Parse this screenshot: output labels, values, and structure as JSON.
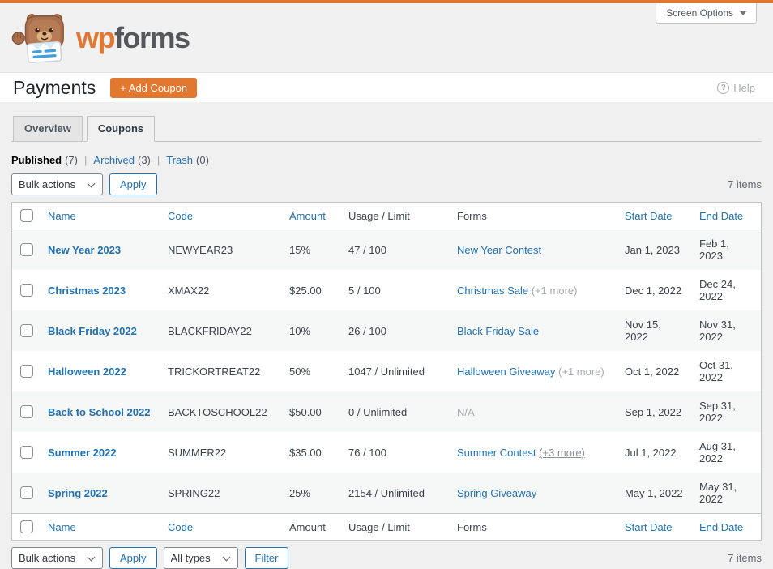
{
  "colors": {
    "accent_orange": "#e27730",
    "link_blue": "#2271b1",
    "muted_gray": "#a7aaad"
  },
  "brand": {
    "wordmark_wp": "wp",
    "wordmark_forms": "forms",
    "screen_options_label": "Screen Options"
  },
  "page_header": {
    "title": "Payments",
    "add_coupon_label": "+ Add Coupon",
    "help_label": "Help",
    "help_icon_glyph": "?"
  },
  "tabs": [
    {
      "label": "Overview",
      "active": false
    },
    {
      "label": "Coupons",
      "active": true
    }
  ],
  "status_filters": {
    "separator": "|",
    "items": [
      {
        "label": "Published",
        "count": "(7)",
        "current": true
      },
      {
        "label": "Archived",
        "count": "(3)",
        "current": false
      },
      {
        "label": "Trash",
        "count": "(0)",
        "current": false
      }
    ]
  },
  "toolbar_top": {
    "bulk_actions_value": "Bulk actions",
    "apply_label": "Apply",
    "items_count": "7 items"
  },
  "toolbar_bottom": {
    "bulk_actions_value": "Bulk actions",
    "apply_label": "Apply",
    "type_filter_value": "All types",
    "filter_label": "Filter",
    "items_count": "7 items"
  },
  "table": {
    "header_columns": [
      {
        "label": "Name",
        "link": true
      },
      {
        "label": "Code",
        "link": true
      },
      {
        "label": "Amount",
        "link": true
      },
      {
        "label": "Usage / Limit",
        "link": false
      },
      {
        "label": "Forms",
        "link": false
      },
      {
        "label": "Start Date",
        "link": true
      },
      {
        "label": "End Date",
        "link": true
      }
    ],
    "footer_columns": [
      {
        "label": "Name",
        "link": true
      },
      {
        "label": "Code",
        "link": true
      },
      {
        "label": "Amount",
        "link": false
      },
      {
        "label": "Usage / Limit",
        "link": false
      },
      {
        "label": "Forms",
        "link": false
      },
      {
        "label": "Start Date",
        "link": true
      },
      {
        "label": "End Date",
        "link": true
      }
    ],
    "rows": [
      {
        "name": "New Year 2023",
        "code": "NEWYEAR23",
        "amount": "15%",
        "usage": "47 / 100",
        "forms_label": "New Year Contest",
        "forms_extra": "",
        "forms_extra_underlined": false,
        "forms_na": "",
        "start_date": "Jan 1, 2023",
        "end_date": "Feb 1, 2023"
      },
      {
        "name": "Christmas 2023",
        "code": "XMAX22",
        "amount": "$25.00",
        "usage": "5 / 100",
        "forms_label": "Christmas Sale",
        "forms_extra": "(+1 more)",
        "forms_extra_underlined": false,
        "forms_na": "",
        "start_date": "Dec 1, 2022",
        "end_date": "Dec 24, 2022"
      },
      {
        "name": "Black Friday 2022",
        "code": "BLACKFRIDAY22",
        "amount": "10%",
        "usage": "26 / 100",
        "forms_label": "Black Friday Sale",
        "forms_extra": "",
        "forms_extra_underlined": false,
        "forms_na": "",
        "start_date": "Nov 15, 2022",
        "end_date": "Nov 31, 2022"
      },
      {
        "name": "Halloween 2022",
        "code": "TRICKORTREAT22",
        "amount": "50%",
        "usage": "1047 / Unlimited",
        "forms_label": "Halloween Giveaway",
        "forms_extra": "(+1 more)",
        "forms_extra_underlined": false,
        "forms_na": "",
        "start_date": "Oct 1, 2022",
        "end_date": "Oct 31, 2022"
      },
      {
        "name": "Back to School 2022",
        "code": "BACKTOSCHOOL22",
        "amount": "$50.00",
        "usage": "0 / Unlimited",
        "forms_label": "",
        "forms_extra": "",
        "forms_extra_underlined": false,
        "forms_na": "N/A",
        "start_date": "Sep 1, 2022",
        "end_date": "Sep 31, 2022"
      },
      {
        "name": "Summer 2022",
        "code": "SUMMER22",
        "amount": "$35.00",
        "usage": "76 / 100",
        "forms_label": "Summer Contest",
        "forms_extra": "(+3 more)",
        "forms_extra_underlined": true,
        "forms_na": "",
        "start_date": "Jul 1, 2022",
        "end_date": "Aug 31, 2022"
      },
      {
        "name": "Spring 2022",
        "code": "SPRING22",
        "amount": "25%",
        "usage": "2154 / Unlimited",
        "forms_label": "Spring Giveaway",
        "forms_extra": "",
        "forms_extra_underlined": false,
        "forms_na": "",
        "start_date": "May 1, 2022",
        "end_date": "May 31, 2022"
      }
    ]
  }
}
